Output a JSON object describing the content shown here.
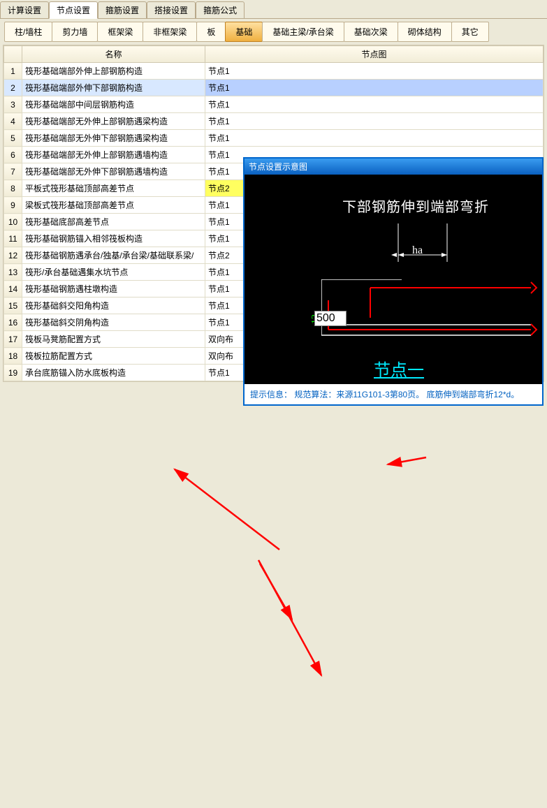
{
  "top_tabs": {
    "items": [
      {
        "label": "计算设置"
      },
      {
        "label": "节点设置"
      },
      {
        "label": "箍筋设置"
      },
      {
        "label": "搭接设置"
      },
      {
        "label": "箍筋公式"
      }
    ],
    "active_index": 1
  },
  "sub_tabs": {
    "items": [
      {
        "label": "柱/墙柱"
      },
      {
        "label": "剪力墙"
      },
      {
        "label": "框架梁"
      },
      {
        "label": "非框架梁"
      },
      {
        "label": "板"
      },
      {
        "label": "基础"
      },
      {
        "label": "基础主梁/承台梁"
      },
      {
        "label": "基础次梁"
      },
      {
        "label": "砌体结构"
      },
      {
        "label": "其它"
      }
    ],
    "active_index": 5
  },
  "table": {
    "headers": {
      "num": "",
      "name": "名称",
      "node": "节点图"
    },
    "selected_index": 1,
    "highlight_index": 7,
    "rows": [
      {
        "num": "1",
        "name": "筏形基础端部外伸上部钢筋构造",
        "node": "节点1"
      },
      {
        "num": "2",
        "name": "筏形基础端部外伸下部钢筋构造",
        "node": "节点1"
      },
      {
        "num": "3",
        "name": "筏形基础端部中间层钢筋构造",
        "node": "节点1"
      },
      {
        "num": "4",
        "name": "筏形基础端部无外伸上部钢筋遇梁构造",
        "node": "节点1"
      },
      {
        "num": "5",
        "name": "筏形基础端部无外伸下部钢筋遇梁构造",
        "node": "节点1"
      },
      {
        "num": "6",
        "name": "筏形基础端部无外伸上部钢筋遇墙构造",
        "node": "节点1"
      },
      {
        "num": "7",
        "name": "筏形基础端部无外伸下部钢筋遇墙构造",
        "node": "节点1"
      },
      {
        "num": "8",
        "name": "平板式筏形基础顶部高差节点",
        "node": "节点2"
      },
      {
        "num": "9",
        "name": "梁板式筏形基础顶部高差节点",
        "node": "节点1"
      },
      {
        "num": "10",
        "name": "筏形基础底部高差节点",
        "node": "节点1"
      },
      {
        "num": "11",
        "name": "筏形基础钢筋锚入相邻筏板构造",
        "node": "节点1"
      },
      {
        "num": "12",
        "name": "筏形基础钢筋遇承台/独基/承台梁/基础联系梁/",
        "node": "节点2"
      },
      {
        "num": "13",
        "name": "筏形/承台基础遇集水坑节点",
        "node": "节点1"
      },
      {
        "num": "14",
        "name": "筏形基础钢筋遇柱墩构造",
        "node": "节点1"
      },
      {
        "num": "15",
        "name": "筏形基础斜交阳角构造",
        "node": "节点1"
      },
      {
        "num": "16",
        "name": "筏形基础斜交阴角构造",
        "node": "节点1"
      },
      {
        "num": "17",
        "name": "筏板马凳筋配置方式",
        "node": "双向布"
      },
      {
        "num": "18",
        "name": "筏板拉筋配置方式",
        "node": "双向布"
      },
      {
        "num": "19",
        "name": "承台底筋锚入防水底板构造",
        "node": "节点1"
      }
    ]
  },
  "diagram": {
    "title": "节点设置示意图",
    "top_text": "下部钢筋伸到端部弯折",
    "label_ha": "ha",
    "value_input": "500",
    "side_label": "12",
    "caption": "节点一",
    "hint": "提示信息： 规范算法：来源11G101-3第80页。 底筋伸到端部弯折12*d。"
  }
}
